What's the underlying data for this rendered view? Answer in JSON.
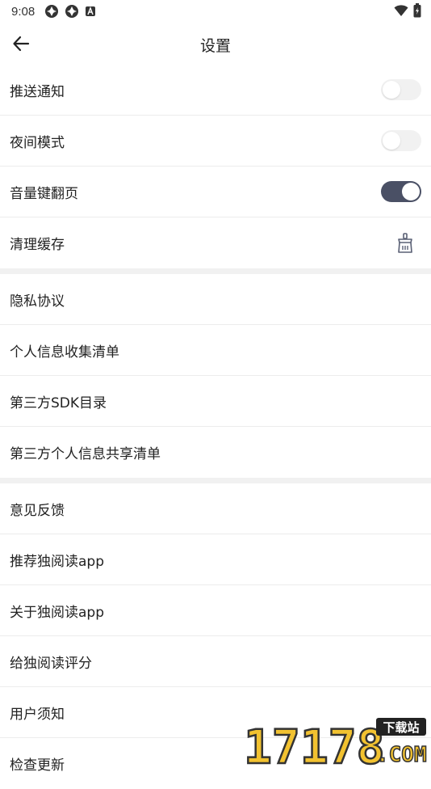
{
  "status_bar": {
    "time": "9:08"
  },
  "header": {
    "title": "设置"
  },
  "sections": [
    [
      {
        "label": "推送通知",
        "control": "toggle",
        "on": false
      },
      {
        "label": "夜间模式",
        "control": "toggle",
        "on": false
      },
      {
        "label": "音量键翻页",
        "control": "toggle",
        "on": true
      },
      {
        "label": "清理缓存",
        "control": "clear-cache-icon"
      }
    ],
    [
      {
        "label": "隐私协议"
      },
      {
        "label": "个人信息收集清单"
      },
      {
        "label": "第三方SDK目录"
      },
      {
        "label": "第三方个人信息共享清单"
      }
    ],
    [
      {
        "label": "意见反馈"
      },
      {
        "label": "推荐独阅读app"
      },
      {
        "label": "关于独阅读app"
      },
      {
        "label": "给独阅读评分"
      },
      {
        "label": "用户须知"
      },
      {
        "label": "检查更新"
      }
    ]
  ],
  "watermark": {
    "text": "17178",
    "badge": "下载站",
    "suffix": ".COM"
  },
  "colors": {
    "toggle_on": "#4a5065",
    "toggle_off": "#f1f1f1",
    "divider": "#ececec",
    "section_gap": "#f1f1f1"
  }
}
